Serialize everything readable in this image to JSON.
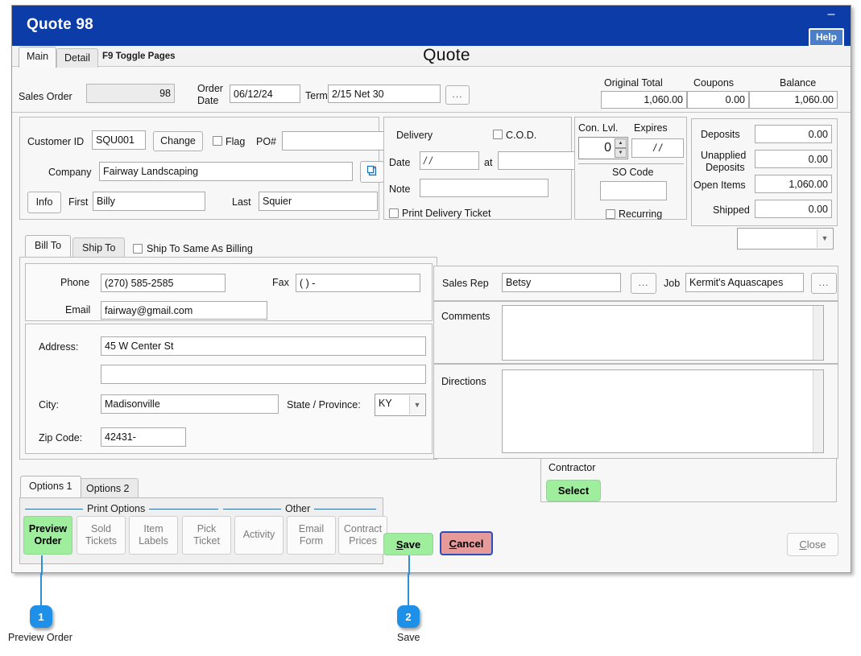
{
  "window": {
    "title": "Quote 98",
    "help_label": "Help",
    "minimize_label": "–",
    "page_title": "Quote"
  },
  "tabs": {
    "main": "Main",
    "detail": "Detail",
    "toggle_note": "F9 Toggle Pages"
  },
  "order": {
    "sales_order_label": "Sales Order",
    "sales_order_value": "98",
    "order_date_label_line1": "Order",
    "order_date_label_line2": "Date",
    "order_date_value": "06/12/24",
    "terms_label": "Terms",
    "terms_value": "2/15 Net 30",
    "terms_browse": "..."
  },
  "totals": {
    "original_total_label": "Original Total",
    "original_total_value": "1,060.00",
    "coupons_label": "Coupons",
    "coupons_value": "0.00",
    "balance_label": "Balance",
    "balance_value": "1,060.00"
  },
  "customer": {
    "customer_id_label": "Customer ID",
    "customer_id_value": "SQU001",
    "change_label": "Change",
    "flag_label": "Flag",
    "flag_checked": false,
    "po_label": "PO#",
    "po_value": "",
    "company_label": "Company",
    "company_value": "Fairway Landscaping",
    "copy_icon": "copy-icon",
    "info_label": "Info",
    "first_label": "First",
    "first_value": "Billy",
    "last_label": "Last",
    "last_value": "Squier"
  },
  "delivery": {
    "group_label": "Delivery",
    "cod_label": "C.O.D.",
    "cod_checked": false,
    "date_label": "Date",
    "date_value": "/  /",
    "at_label": "at",
    "at_value": "",
    "note_label": "Note",
    "note_value": "",
    "print_ticket_label": "Print Delivery Ticket",
    "print_ticket_checked": false
  },
  "confidence": {
    "con_lvl_label": "Con. Lvl.",
    "con_lvl_value": "0",
    "expires_label": "Expires",
    "expires_value": "/  /",
    "so_code_label": "SO Code",
    "so_code_value": "",
    "recurring_label": "Recurring",
    "recurring_checked": false
  },
  "amounts": {
    "deposits_label": "Deposits",
    "deposits_value": "0.00",
    "unapplied_label_line1": "Unapplied",
    "unapplied_label_line2": "Deposits",
    "unapplied_value": "0.00",
    "open_items_label": "Open Items",
    "open_items_value": "1,060.00",
    "shipped_label": "Shipped",
    "shipped_value": "0.00",
    "status_dropdown_value": ""
  },
  "address": {
    "bill_to_tab": "Bill To",
    "ship_to_tab": "Ship To",
    "same_as_billing_label": "Ship To Same As Billing",
    "same_as_billing_checked": false,
    "phone_label": "Phone",
    "phone_value": "(270) 585-2585",
    "fax_label": "Fax",
    "fax_value": "(    )      -",
    "email_label": "Email",
    "email_value": "fairway@gmail.com",
    "address_label": "Address:",
    "address_line1": "45 W Center St",
    "address_line2": "",
    "city_label": "City:",
    "city_value": "Madisonville",
    "state_label": "State / Province:",
    "state_value": "KY",
    "zip_label": "Zip Code:",
    "zip_value": "42431-"
  },
  "rep": {
    "sales_rep_label": "Sales Rep",
    "sales_rep_value": "Betsy",
    "sales_rep_browse": "...",
    "job_label": "Job",
    "job_value": "Kermit's Aquascapes",
    "job_browse": "...",
    "comments_label": "Comments",
    "comments_value": "",
    "directions_label": "Directions",
    "directions_value": ""
  },
  "contractor": {
    "group_label": "Contractor",
    "select_label": "Select"
  },
  "options": {
    "tab1": "Options 1",
    "tab2": "Options 2",
    "print_options_label": "Print Options",
    "other_label": "Other",
    "buttons": [
      {
        "line1": "Preview",
        "line2": "Order",
        "name": "preview-order-button",
        "highlight": true
      },
      {
        "line1": "Sold",
        "line2": "Tickets",
        "name": "sold-tickets-button",
        "highlight": false
      },
      {
        "line1": "Item",
        "line2": "Labels",
        "name": "item-labels-button",
        "highlight": false
      },
      {
        "line1": "Pick",
        "line2": "Ticket",
        "name": "pick-ticket-button",
        "highlight": false
      },
      {
        "line1": "Activity",
        "line2": "",
        "name": "activity-button",
        "highlight": false
      },
      {
        "line1": "Email",
        "line2": "Form",
        "name": "email-form-button",
        "highlight": false
      },
      {
        "line1": "Contract",
        "line2": "Prices",
        "name": "contract-prices-button",
        "highlight": false
      }
    ]
  },
  "actions": {
    "save_label": "Save",
    "cancel_label": "Cancel",
    "close_label": "Close"
  },
  "annotations": [
    {
      "number": "1",
      "caption": "Preview Order"
    },
    {
      "number": "2",
      "caption": "Save"
    }
  ],
  "colors": {
    "titlebar": "#0B3CA8",
    "accent_green": "#9EEE9E",
    "accent_red": "#E79A9A",
    "callout_blue": "#1E90E8",
    "separator_blue": "#2E6DA4"
  }
}
